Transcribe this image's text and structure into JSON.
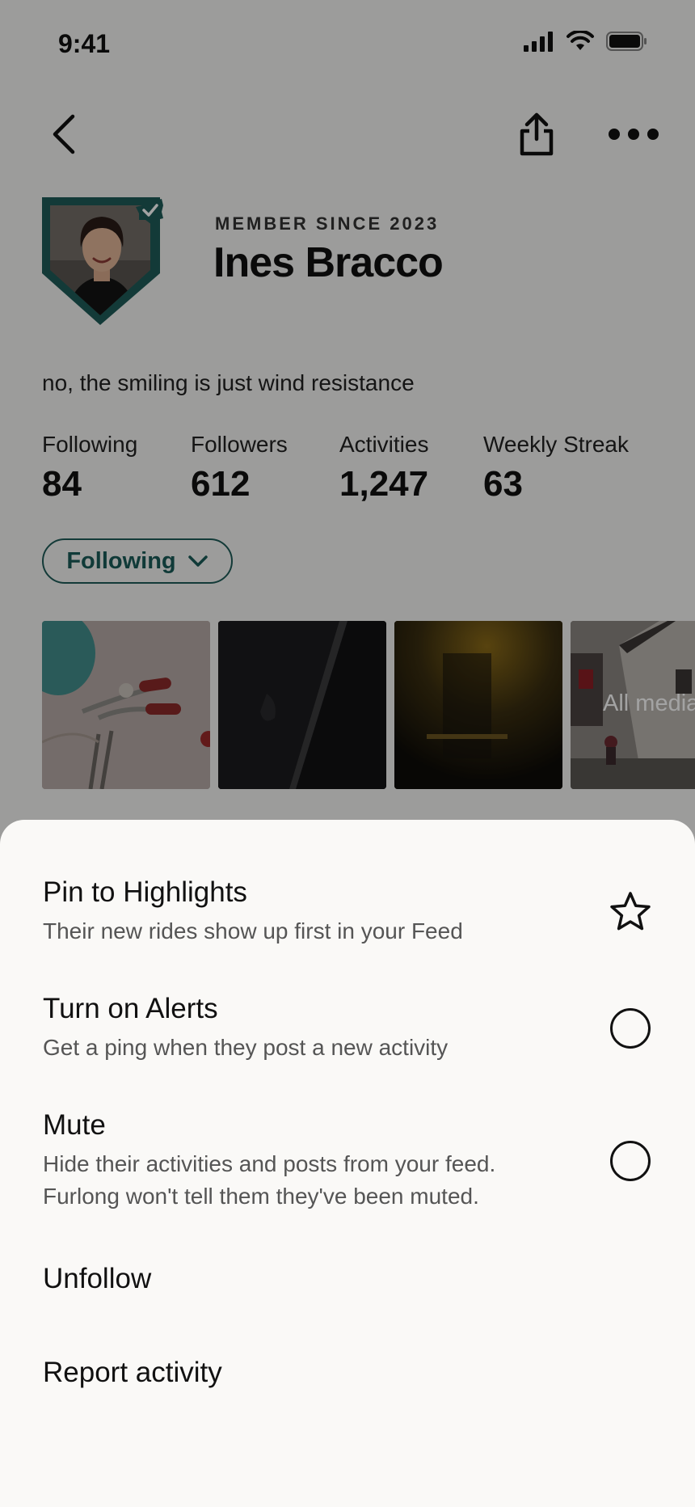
{
  "status_bar": {
    "time": "9:41"
  },
  "profile": {
    "member_since": "MEMBER SINCE 2023",
    "name": "Ines Bracco",
    "bio": "no, the smiling is just wind resistance",
    "stats": [
      {
        "label": "Following",
        "value": "84"
      },
      {
        "label": "Followers",
        "value": "612"
      },
      {
        "label": "Activities",
        "value": "1,247"
      },
      {
        "label": "Weekly Streak",
        "value": "63"
      }
    ],
    "follow_button": "Following",
    "all_media_label": "All media"
  },
  "sheet": {
    "options": [
      {
        "title": "Pin to Highlights",
        "subtitle": "Their new rides show up first in your Feed",
        "icon": "star-icon"
      },
      {
        "title": "Turn on Alerts",
        "subtitle": "Get a ping when they post a new activity",
        "icon": "radio-icon"
      },
      {
        "title": "Mute",
        "subtitle_lines": [
          "Hide their activities and posts from your feed.",
          "Furlong won't tell them they've been muted."
        ],
        "icon": "radio-icon"
      }
    ],
    "unfollow": "Unfollow",
    "report": "Report activity"
  },
  "colors": {
    "accent": "#1f5c58",
    "sheet_bg": "#faf9f7"
  }
}
